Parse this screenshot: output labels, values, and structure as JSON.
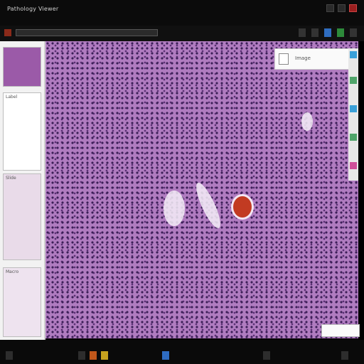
{
  "window": {
    "title": "Pathology Viewer"
  },
  "address": {
    "value": ""
  },
  "sidebar": {
    "thumbs": [
      {
        "caption": ""
      },
      {
        "caption": "Label"
      },
      {
        "caption": "Slide"
      },
      {
        "caption": "Macro"
      }
    ]
  },
  "viewer": {
    "tissue": "H&E stained histology section"
  },
  "panel": {
    "label": "Image"
  },
  "scale": {
    "label": ""
  },
  "colors": {
    "accent": "#3aa0d8",
    "stain": "#b07cc0",
    "rbc": "#c23b22"
  }
}
